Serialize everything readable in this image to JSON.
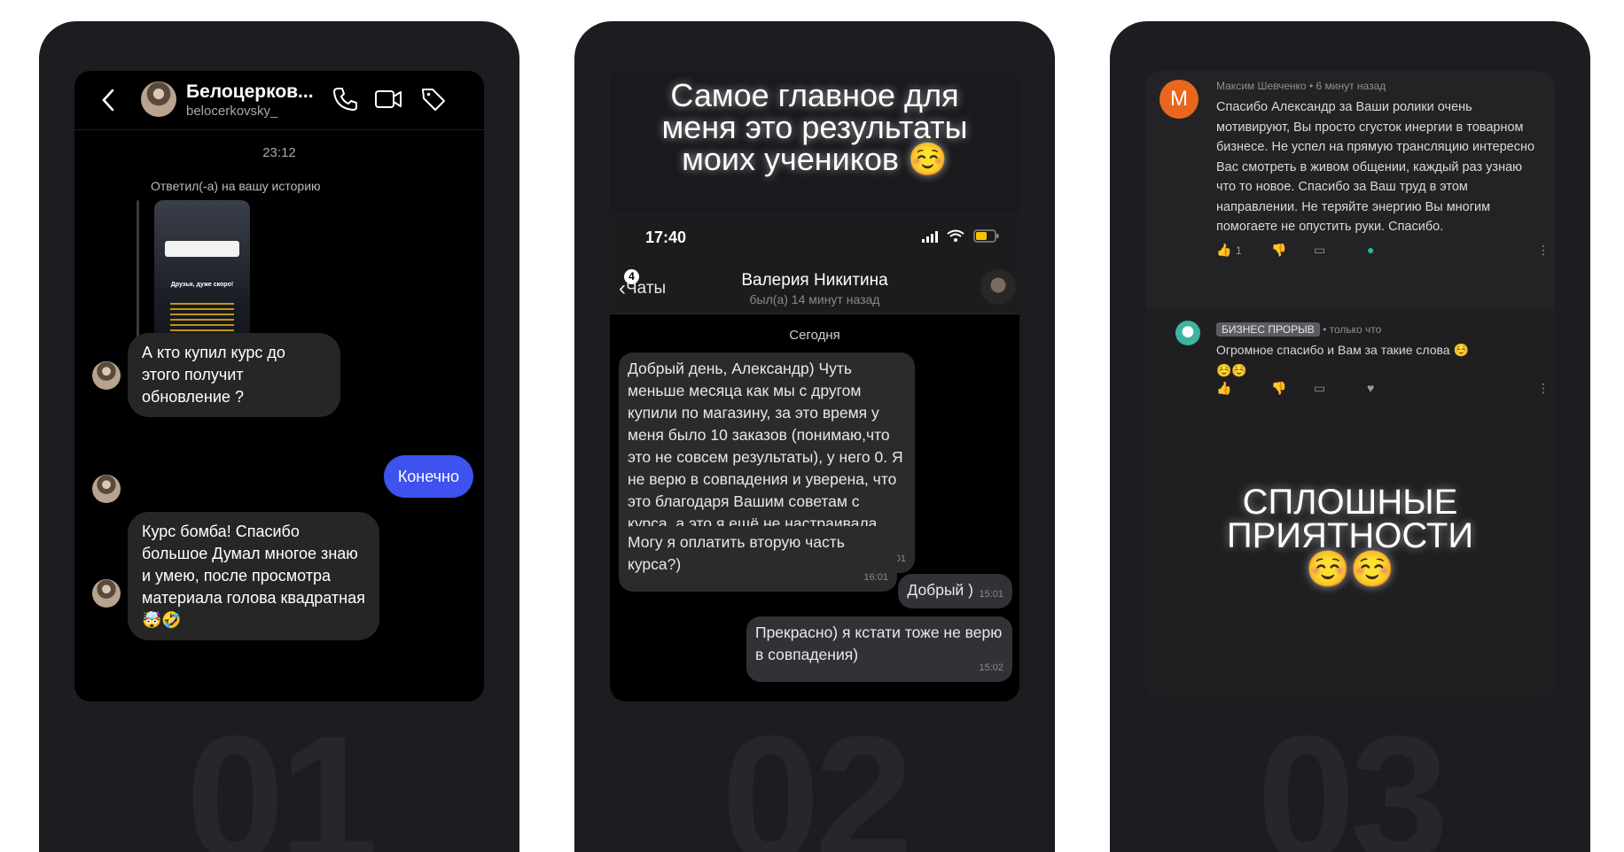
{
  "cards": [
    {
      "number": "01",
      "chat": {
        "contact_name": "Белоцерков...",
        "contact_handle": "belocerkovsky_",
        "time": "23:12",
        "replied_to_story": "Ответил(-а) на вашу историю",
        "story_heading": "Друзья, дуже скоро!",
        "messages": [
          {
            "from": "contact",
            "text": "А кто купил курс до этого получит обновление ?"
          },
          {
            "from": "me",
            "text": "Конечно"
          },
          {
            "from": "contact",
            "text": "👍👍👍"
          },
          {
            "from": "contact",
            "text": "Курс бомба! Спасибо большое Думал многое знаю и умею, после просмотра материала голова квадратная 🤯🤣"
          }
        ]
      }
    },
    {
      "number": "02",
      "title": "Самое главное для меня это результаты моих учеников ☺️",
      "chat": {
        "status_time": "17:40",
        "back_label": "Чаты",
        "unread_badge": "4",
        "contact_name": "Валерия Никитина",
        "last_seen": "был(а) 14 минут назад",
        "day_label": "Сегодня",
        "messages": [
          {
            "from": "contact",
            "text": "Добрый день, Александр) Чуть меньше месяца как мы с другом купили по магазину, за это время у меня было 10 заказов (понимаю,что это не совсем результаты), у него 0. Я не верю в совпадения и уверена, что это благодаря Вашим советам с курса, а это я ещё не настраивала просейл по Вашем рекомендациям",
            "time": "15:01"
          },
          {
            "from": "contact",
            "text": "Могу я оплатить вторую часть курса?)",
            "time": "16:01"
          },
          {
            "from": "me",
            "text": "Добрый )",
            "time": "15:01"
          },
          {
            "from": "me",
            "text": "Прекрасно) я кстати тоже не верю в совпадения)",
            "time": "15:02"
          }
        ]
      }
    },
    {
      "number": "03",
      "comments": [
        {
          "avatar_letter": "М",
          "author": "Максим Шевченко",
          "when": "6 минут назад",
          "text": "Спасибо Александр за Ваши ролики очень мотивируют, Вы просто сгусток инергии в товарном бизнесе. Не успел на прямую трансляцию интересно Вас смотреть в живом общении, каждый раз узнаю что то новое. Спасибо за Ваш труд в этом направлении. Не теряйте энергию Вы многим помогаете не опустить руки. Спасибо.",
          "likes": "1"
        },
        {
          "author": "БИЗНЕС ПРОРЫВ",
          "when": "только что",
          "text": "Огромное спасибо и Вам за такие слова ☺️☺️☺️"
        }
      ],
      "caption": "СПЛОШНЫЕ ПРИЯТНОСТИ ☺️☺️"
    }
  ]
}
